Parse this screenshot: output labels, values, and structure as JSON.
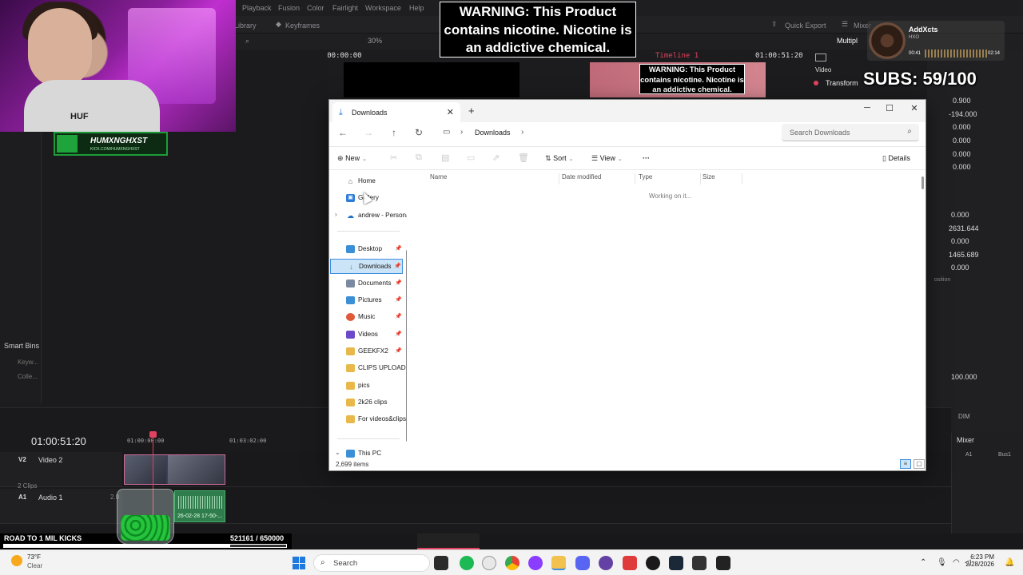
{
  "resolve": {
    "menu": [
      "Playback",
      "Fusion",
      "Color",
      "Fairlight",
      "Workspace",
      "Help"
    ],
    "toolbar": {
      "library": "Library",
      "keyframes": "Keyframes",
      "quick_export": "Quick Export",
      "mixer": "Mixer",
      "multiple": "Multipl",
      "zoom": "30%"
    },
    "viewer": {
      "source_tc": "00:00:00:00",
      "timeline_name": "Timeline 1",
      "timeline_tc": "01:00:51:20"
    },
    "inspector": {
      "video_tab": "Video",
      "transform": "Transform",
      "values": [
        "0.900",
        "-194.000",
        "0.000",
        "0.000",
        "0.000",
        "0.000",
        "0.000",
        "2631.644",
        "0.000",
        "1465.689",
        "0.000",
        "100.000"
      ],
      "position_label": "osition"
    },
    "media_pool": {
      "smart_bins": "Smart Bins",
      "items": [
        "Keyw...",
        "Colle..."
      ]
    },
    "timeline": {
      "timecode": "01:00:51:20",
      "ruler": [
        "01:00:00:00",
        "01:03:02:00"
      ],
      "tracks": [
        {
          "id": "V2",
          "name": "Video 2",
          "info": "2 Clips"
        },
        {
          "id": "A1",
          "name": "Audio 1",
          "info": "2.0"
        }
      ],
      "audio_clip_label": "26-02-28 17-50-...",
      "dim_label": "DIM"
    },
    "mixer": {
      "title": "Mixer",
      "channels": [
        "A1",
        "Bus1"
      ]
    }
  },
  "stream": {
    "brand_name": "HUMXNGHXST",
    "brand_sub": "KICK.COM/HUMXNGHXST",
    "shirt_text": "HUF",
    "warning": "WARNING: This Product contains nicotine. Nicotine is an addictive chemical.",
    "subs": "SUBS: 59/100",
    "now_playing": {
      "title": "AddXcts",
      "artist": "HXO",
      "elapsed": "00:41",
      "total": "02:14"
    },
    "goal": {
      "label": "ROAD TO 1 MIL KICKS",
      "count": "521161",
      "target": "/ 650000",
      "progress": 0.8018
    }
  },
  "explorer": {
    "tab_title": "Downloads",
    "address": "Downloads",
    "search_placeholder": "Search Downloads",
    "commands": {
      "new": "New",
      "sort": "Sort",
      "view": "View",
      "details": "Details"
    },
    "sidebar": [
      {
        "label": "Home",
        "icon": "home-icon",
        "color": "#555555"
      },
      {
        "label": "Gallery",
        "icon": "gallery-icon",
        "color": "#2b7bd8"
      },
      {
        "label": "andrew - Personal",
        "icon": "onedrive-icon",
        "color": "#1a73c8"
      },
      {
        "label": "Desktop",
        "icon": "desktop-icon",
        "color": "#3a8fd6"
      },
      {
        "label": "Downloads",
        "icon": "downloads-icon",
        "color": "#2aa84a"
      },
      {
        "label": "Documents",
        "icon": "documents-icon",
        "color": "#7a8aa0"
      },
      {
        "label": "Pictures",
        "icon": "pictures-icon",
        "color": "#3a8fd6"
      },
      {
        "label": "Music",
        "icon": "music-icon",
        "color": "#e05a3a"
      },
      {
        "label": "Videos",
        "icon": "videos-icon",
        "color": "#6b49c8"
      },
      {
        "label": "GEEKFX2",
        "icon": "folder-icon",
        "color": "#e8b94a"
      },
      {
        "label": "CLIPS UPLOAD",
        "icon": "folder-icon",
        "color": "#e8b94a"
      },
      {
        "label": "pics",
        "icon": "folder-icon",
        "color": "#e8b94a"
      },
      {
        "label": "2k26 clips",
        "icon": "folder-icon",
        "color": "#e8b94a"
      },
      {
        "label": "For videos&clips",
        "icon": "folder-icon",
        "color": "#e8b94a"
      },
      {
        "label": "This PC",
        "icon": "pc-icon",
        "color": "#3a8fd6"
      }
    ],
    "columns": [
      "Name",
      "Date modified",
      "Type",
      "Size"
    ],
    "loading_text": "Working on it...",
    "status": "2,699 items"
  },
  "taskbar": {
    "weather_temp": "73°F",
    "weather_cond": "Clear",
    "search_label": "Search",
    "time": "6:23 PM",
    "date": "2/28/2026"
  }
}
